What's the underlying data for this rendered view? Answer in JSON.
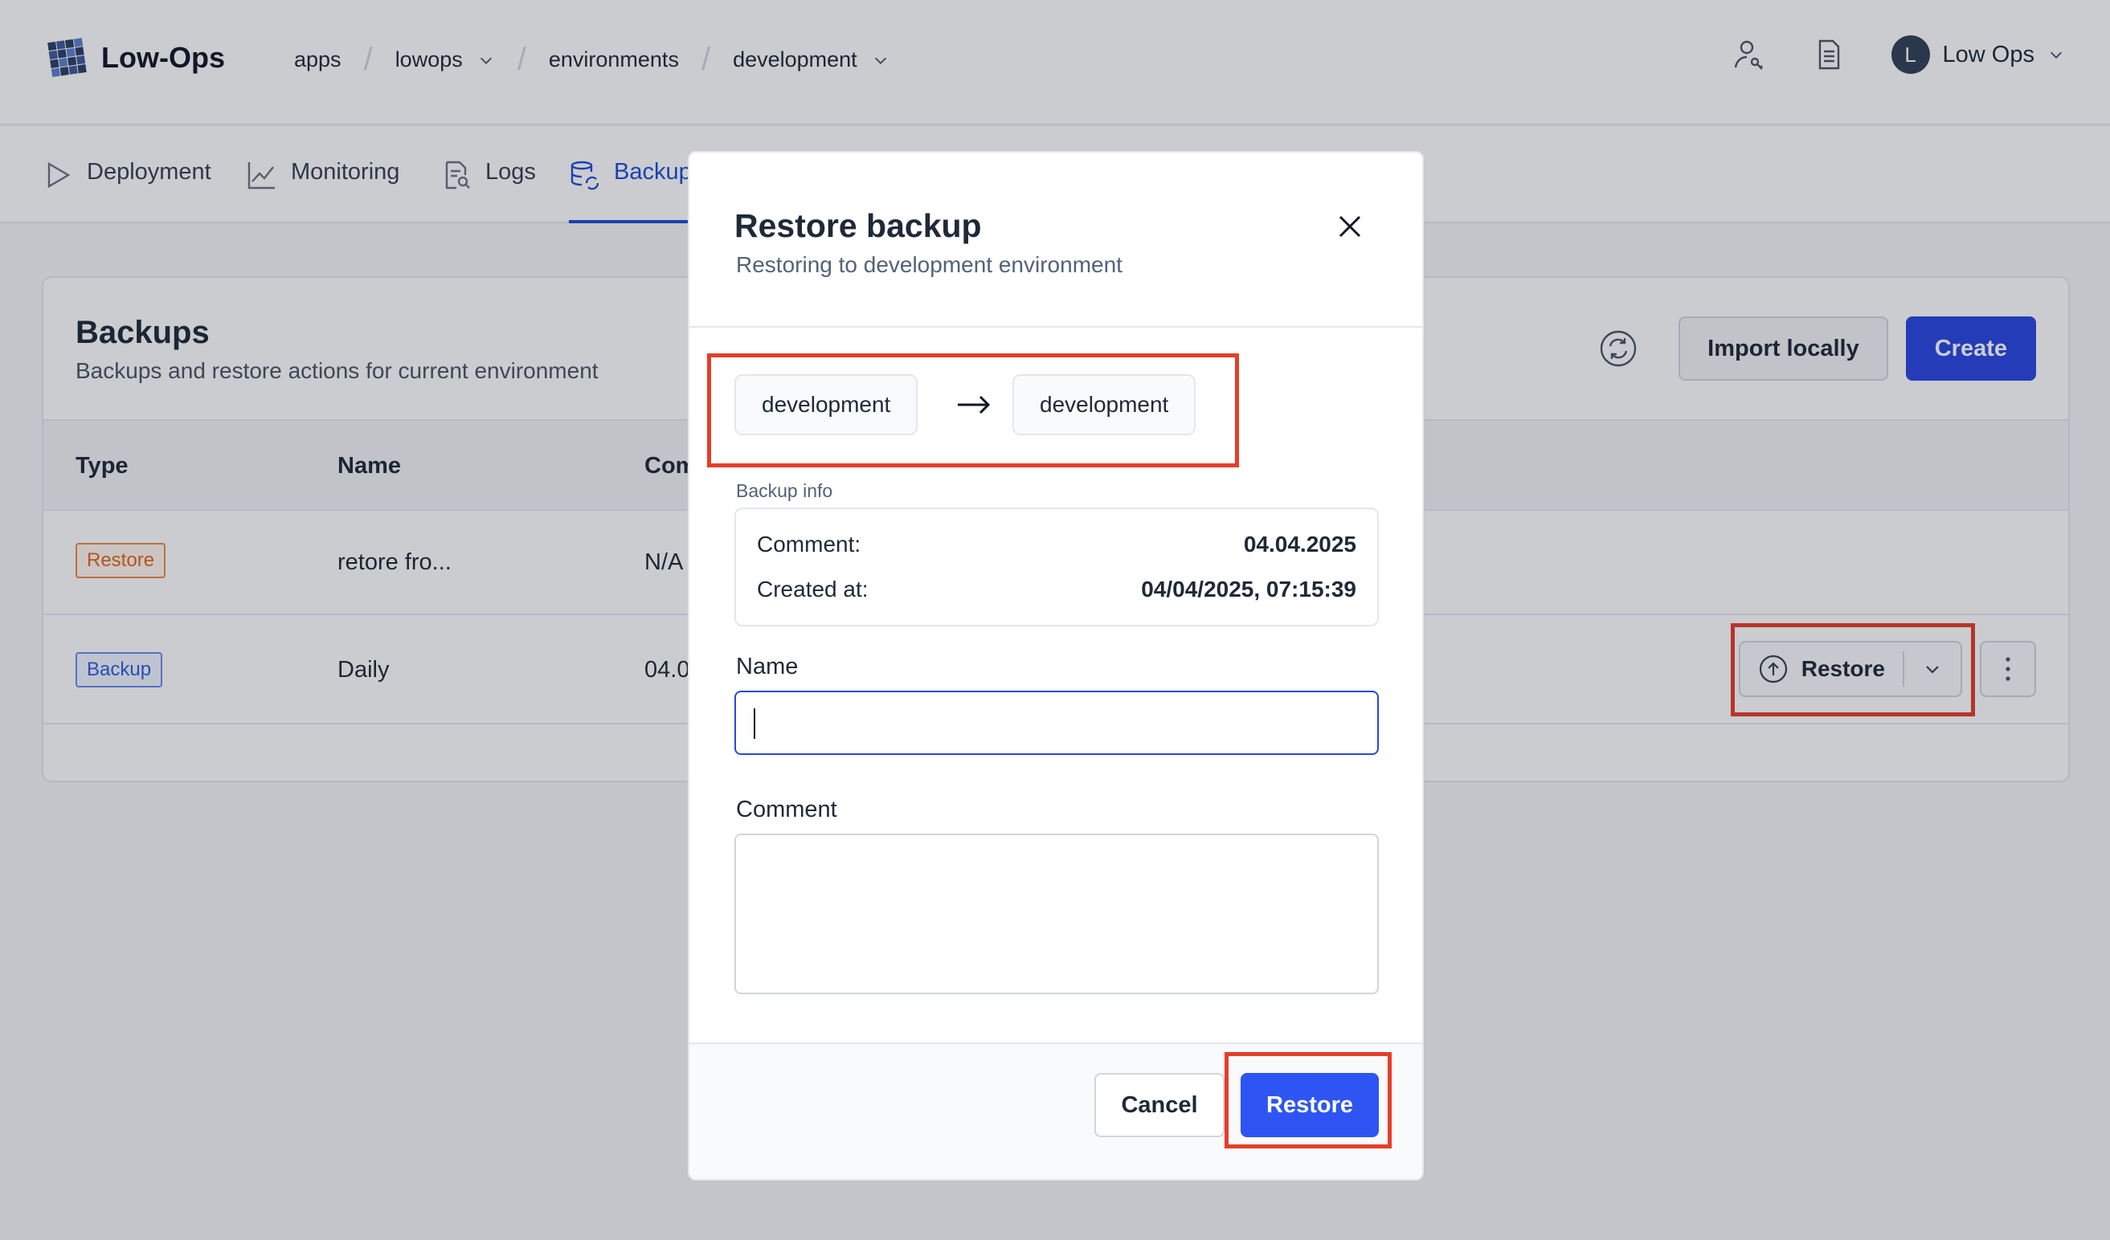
{
  "app": {
    "name": "Low-Ops"
  },
  "breadcrumb": [
    "apps",
    "lowops",
    "environments",
    "development"
  ],
  "user": {
    "initial": "L",
    "name": "Low Ops"
  },
  "tabs": [
    "Deployment",
    "Monitoring",
    "Logs",
    "Backups"
  ],
  "backups": {
    "title": "Backups",
    "subtitle": "Backups and restore actions for current environment",
    "import_label": "Import locally",
    "create_label": "Create",
    "columns": [
      "Type",
      "Name",
      "Com"
    ],
    "rows": [
      {
        "type": "Restore",
        "name": "retore fro...",
        "comment": "N/A"
      },
      {
        "type": "Backup",
        "name": "Daily",
        "comment": "04.0"
      }
    ],
    "row_restore_label": "Restore"
  },
  "modal": {
    "title": "Restore backup",
    "subtitle": "Restoring to development environment",
    "source_env": "development",
    "target_env": "development",
    "info_label": "Backup info",
    "comment_key": "Comment:",
    "comment_value": "04.04.2025",
    "created_key": "Created at:",
    "created_value": "04/04/2025, 07:15:39",
    "name_label": "Name",
    "name_value": "",
    "comment_label": "Comment",
    "comment_field_value": "",
    "cancel_label": "Cancel",
    "restore_label": "Restore"
  },
  "colors": {
    "primary": "#2947e0",
    "highlight": "#e53e2a",
    "restore_badge": "#e2661c",
    "backup_badge": "#2d5fd6"
  }
}
